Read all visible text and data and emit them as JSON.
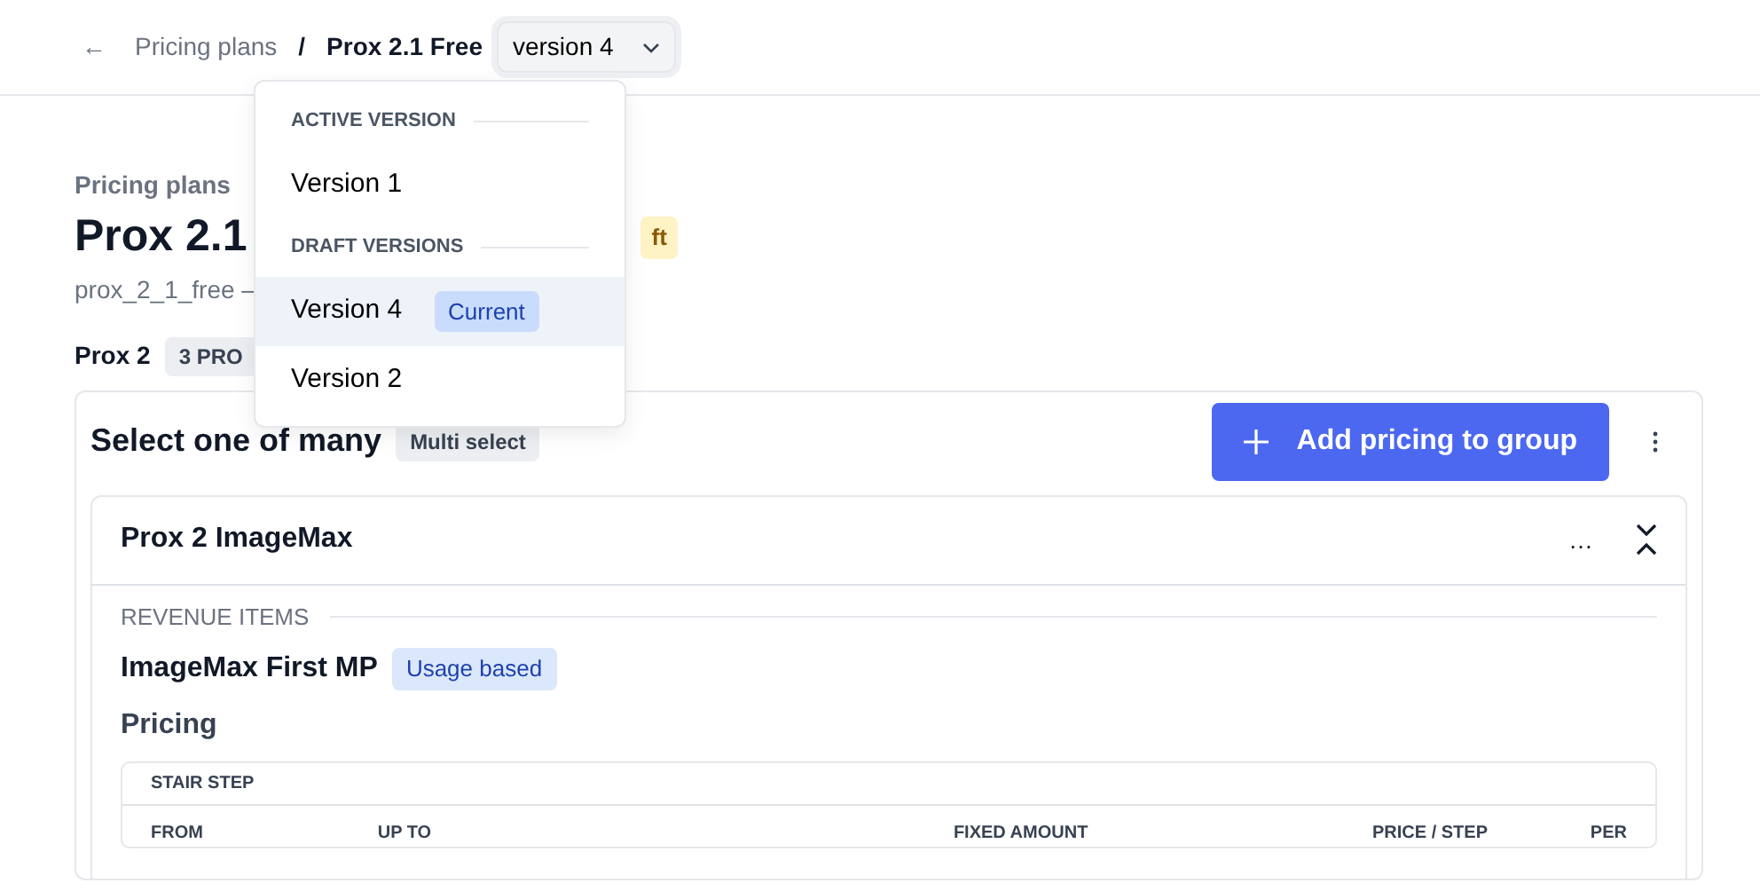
{
  "breadcrumb": {
    "back": "←",
    "parent": "Pricing plans",
    "separator": "/",
    "current": "Prox 2.1 Free",
    "version_select": "version 4",
    "menu_open": true
  },
  "version_menu": {
    "sections": [
      {
        "heading": "ACTIVE VERSION",
        "items": [
          {
            "label": "Version 1",
            "selected": false
          }
        ]
      },
      {
        "heading": "DRAFT VERSIONS",
        "items": [
          {
            "label": "Version 4",
            "badge": "Current",
            "selected": true
          },
          {
            "label": "Version 2",
            "selected": false
          }
        ]
      }
    ]
  },
  "page": {
    "eyebrow": "Pricing plans",
    "title": "Prox 2.1",
    "status_badge": "ft",
    "key": "prox_2_1_free –"
  },
  "group": {
    "name": "Prox 2",
    "count_badge": "3 PRO",
    "title": "Select one of many",
    "type_badge": "Multi select",
    "add_button": "Add pricing to group",
    "product": {
      "name": "Prox 2 ImageMax",
      "more": "…",
      "expanded": true,
      "section": "REVENUE ITEMS",
      "item": "ImageMax First MP",
      "item_badge": "Usage based",
      "pricing": "Pricing",
      "table": {
        "title": "STAIR STEP",
        "columns": [
          "FROM",
          "UP TO",
          "FIXED AMOUNT",
          "PRICE / STEP",
          "PER"
        ]
      }
    }
  }
}
